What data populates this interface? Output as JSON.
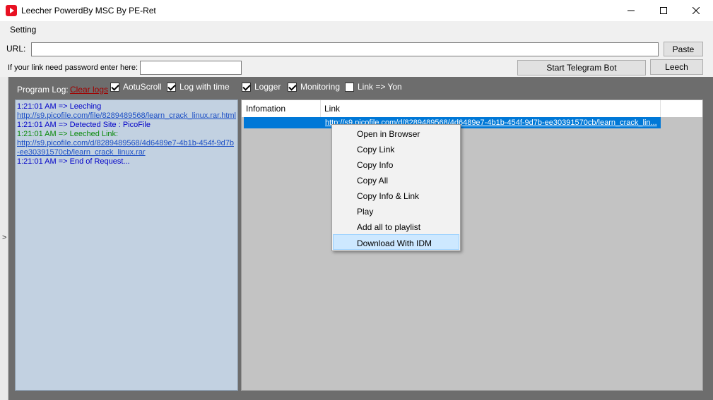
{
  "window": {
    "title": "Leecher PowerdBy MSC By PE-Ret"
  },
  "menu": {
    "setting": "Setting"
  },
  "url_row": {
    "label": "URL:",
    "value": "",
    "paste_label": "Paste"
  },
  "password_row": {
    "label": "If your link need password enter here:",
    "value": "",
    "telegram_label": "Start Telegram Bot",
    "leech_label": "Leech"
  },
  "log_toolbar": {
    "label": "Program Log:",
    "clear_label": "Clear logs",
    "options": [
      {
        "label": "AotuScroll",
        "checked": true
      },
      {
        "label": "Log with time",
        "checked": true
      },
      {
        "label": "Logger",
        "checked": true
      },
      {
        "label": "Monitoring",
        "checked": true
      },
      {
        "label": "Link => Yon",
        "checked": false
      }
    ]
  },
  "log": {
    "lines": [
      "1:21:01 AM => Leeching",
      "http://s9.picofile.com/file/8289489568/learn_crack_linux.rar.html",
      "1:21:01 AM => Detected Site : PicoFile",
      "1:21:01 AM => Leeched Link:",
      "http://s9.picofile.com/d/8289489568/4d6489e7-4b1b-454f-9d7b-ee30391570cb/learn_crack_linux.rar",
      "1:21:01 AM => End of Request..."
    ]
  },
  "results": {
    "columns": [
      "Infomation",
      "Link"
    ],
    "rows": [
      {
        "info": "",
        "link": "http://s9.picofile.com/d/8289489568/4d6489e7-4b1b-454f-9d7b-ee30391570cb/learn_crack_lin..."
      }
    ]
  },
  "context_menu": {
    "items": [
      "Open in Browser",
      "Copy Link",
      "Copy Info",
      "Copy All",
      "Copy Info & Link",
      "Play",
      "Add all to playlist",
      "Download With IDM"
    ],
    "highlighted": "Download With IDM"
  },
  "icons": {
    "app": "app-icon",
    "minimize": "minimize-icon",
    "maximize": "maximize-icon",
    "close": "close-icon",
    "collapse": "chevron-right-icon"
  },
  "colors": {
    "selection": "#0078d7",
    "log_background": "#c2d1e1",
    "menu_highlight": "#cde8ff"
  }
}
